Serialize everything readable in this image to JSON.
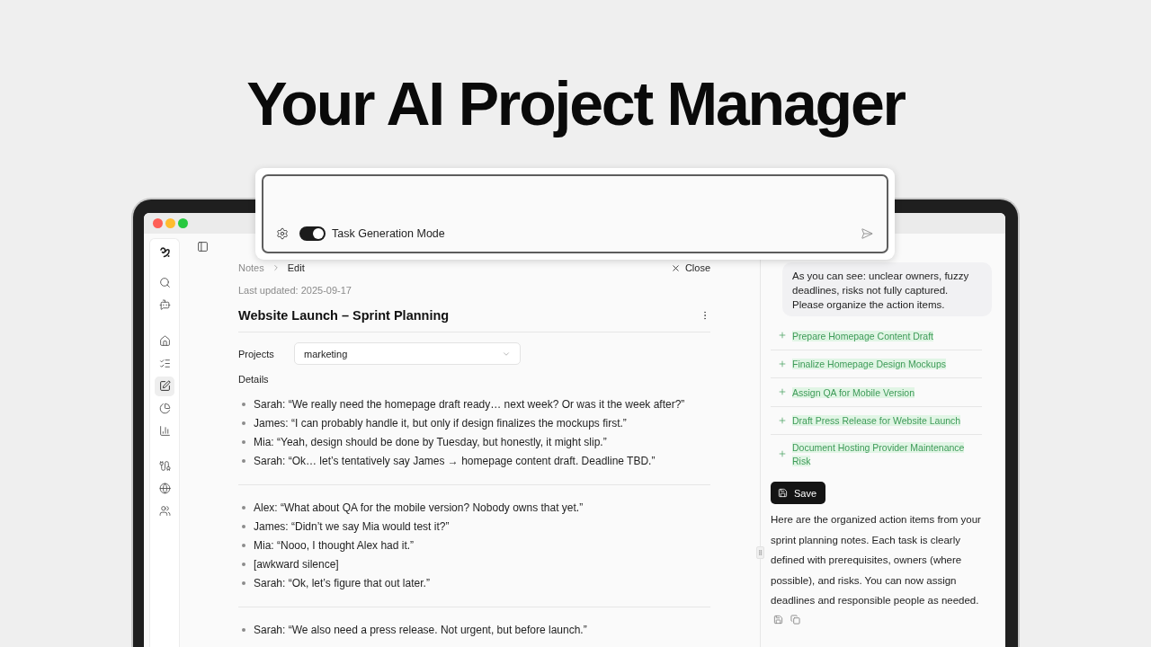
{
  "headline": "Your AI Project Manager",
  "prompt_box": {
    "toggle": {
      "label": "Task Generation Mode",
      "on": true
    }
  },
  "nav_rail": {
    "groups": [
      {
        "items": [
          {
            "selected": false
          },
          {
            "selected": false
          }
        ]
      },
      {
        "items": [
          {
            "selected": false
          },
          {
            "selected": false
          },
          {
            "selected": true
          },
          {
            "selected": false
          },
          {
            "selected": false
          }
        ]
      },
      {
        "items": [
          {
            "selected": false
          },
          {
            "selected": false
          },
          {
            "selected": false
          }
        ]
      }
    ]
  },
  "breadcrumb": {
    "items": [
      "Notes",
      "Edit"
    ],
    "close": "Close"
  },
  "note": {
    "last_updated": "Last updated: 2025-09-17",
    "title": "Website Launch – Sprint Planning",
    "projects": {
      "label": "Projects",
      "value": "marketing"
    },
    "details_label": "Details",
    "sections": [
      {
        "lines": [
          "Sarah: “We really need the homepage draft ready… next week? Or was it the week after?”",
          "James: “I can probably handle it, but only if design finalizes the mockups first.”",
          "Mia: “Yeah, design should be done by Tuesday, but honestly, it might slip.”",
          "Sarah: “Ok… let’s tentatively say James → homepage content draft. Deadline TBD.”"
        ]
      },
      {
        "lines": [
          "Alex: “What about QA for the mobile version? Nobody owns that yet.”",
          "James: “Didn’t we say Mia would test it?”",
          "Mia: “Nooo, I thought Alex had it.”",
          "[awkward silence]",
          "Sarah: “Ok, let’s figure that out later.”"
        ]
      },
      {
        "lines": [
          "Sarah: “We also need a press release. Not urgent, but before launch.”"
        ]
      }
    ]
  },
  "assistant": {
    "user_message": "As you can see: unclear owners, fuzzy deadlines, risks not fully captured. Please organize the action items.",
    "tasks": [
      "Prepare Homepage Content Draft",
      "Finalize Homepage Design Mockups",
      "Assign QA for Mobile Version",
      "Draft Press Release for Website Launch",
      "Document Hosting Provider Maintenance Risk"
    ],
    "save_label": "Save",
    "reply": "Here are the organized action items from your sprint planning notes. Each task is clearly defined with prerequisites, owners (where possible), and risks. You can now assign deadlines and responsible people as needed."
  }
}
